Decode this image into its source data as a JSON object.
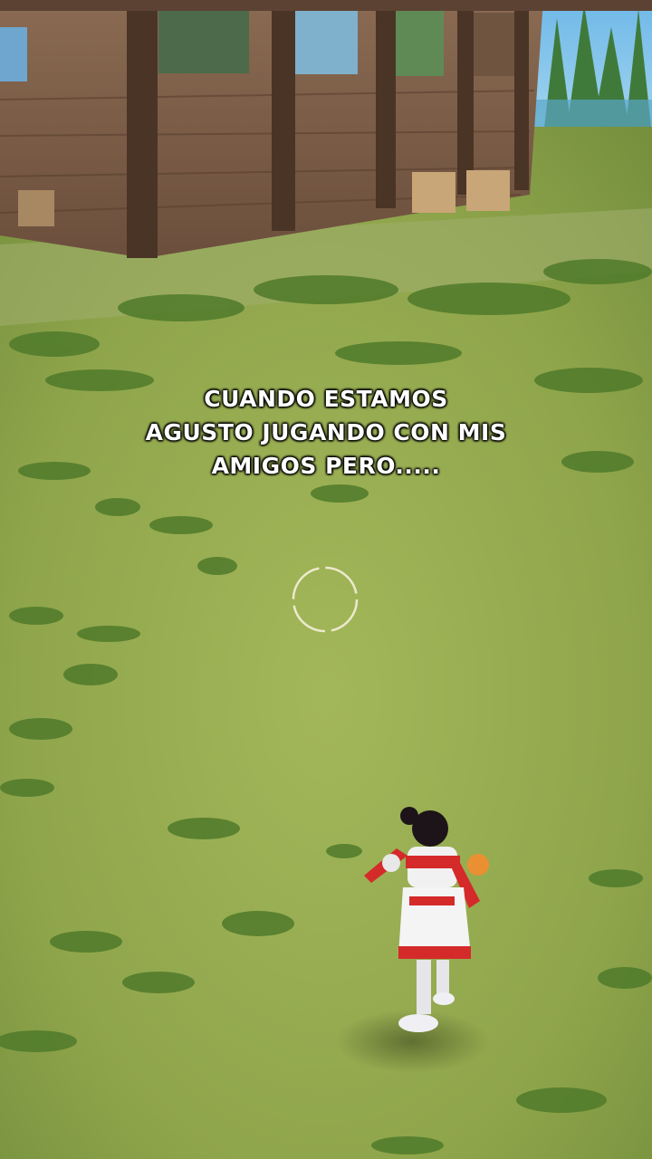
{
  "caption": {
    "line1": "CUANDO ESTAMOS",
    "line2": "AGUSTO JUGANDO CON MIS",
    "line3": "AMIGOS PERO....."
  },
  "icons": {
    "crosshair": "aim-reticle-icon",
    "player": "player-character"
  },
  "colors": {
    "grass": "#8aa24a",
    "caption_text": "#ffffff",
    "character_outfit": "#d42a2a"
  }
}
